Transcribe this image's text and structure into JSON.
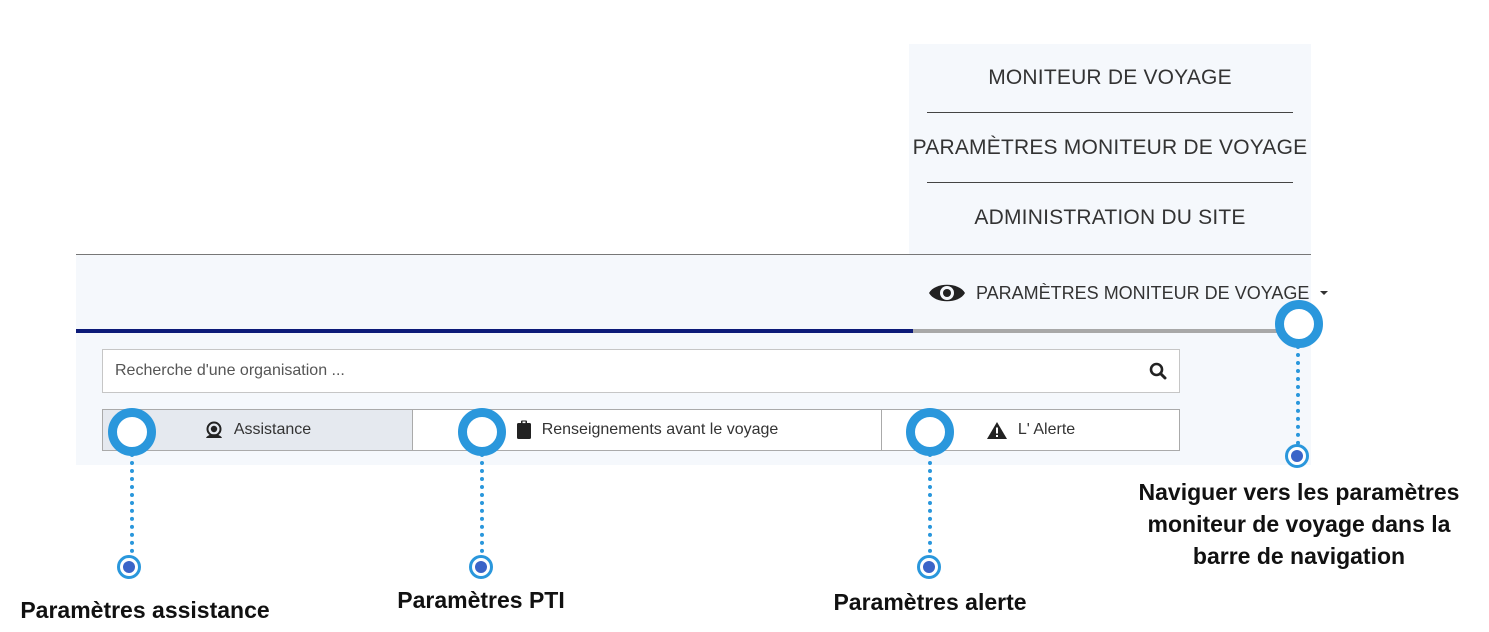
{
  "dropdown": {
    "items": [
      "MONITEUR DE VOYAGE",
      "PARAMÈTRES MONITEUR DE VOYAGE",
      "ADMINISTRATION DU SITE"
    ]
  },
  "navbar": {
    "active_link": "PARAMÈTRES MONITEUR DE VOYAGE",
    "link_icon": "eye-icon"
  },
  "search": {
    "placeholder": "Recherche d'une organisation ..."
  },
  "tabs": [
    {
      "label": "Assistance",
      "icon": "support-agent-icon",
      "active": true
    },
    {
      "label": "Renseignements avant le voyage",
      "icon": "clipboard-icon",
      "active": false
    },
    {
      "label": "L' Alerte",
      "icon": "warning-icon",
      "active": false
    }
  ],
  "annotations": {
    "assistance": "Paramètres assistance",
    "pti": "Paramètres PTI",
    "alerte": "Paramètres alerte",
    "nav_line1": "Naviguer vers les paramètres",
    "nav_line2": "moniteur de voyage dans la",
    "nav_line3": "barre de navigation"
  },
  "colors": {
    "accent": "#2a97dc",
    "nav_blue": "#0c1a78",
    "panel_bg": "#f5f8fc"
  }
}
